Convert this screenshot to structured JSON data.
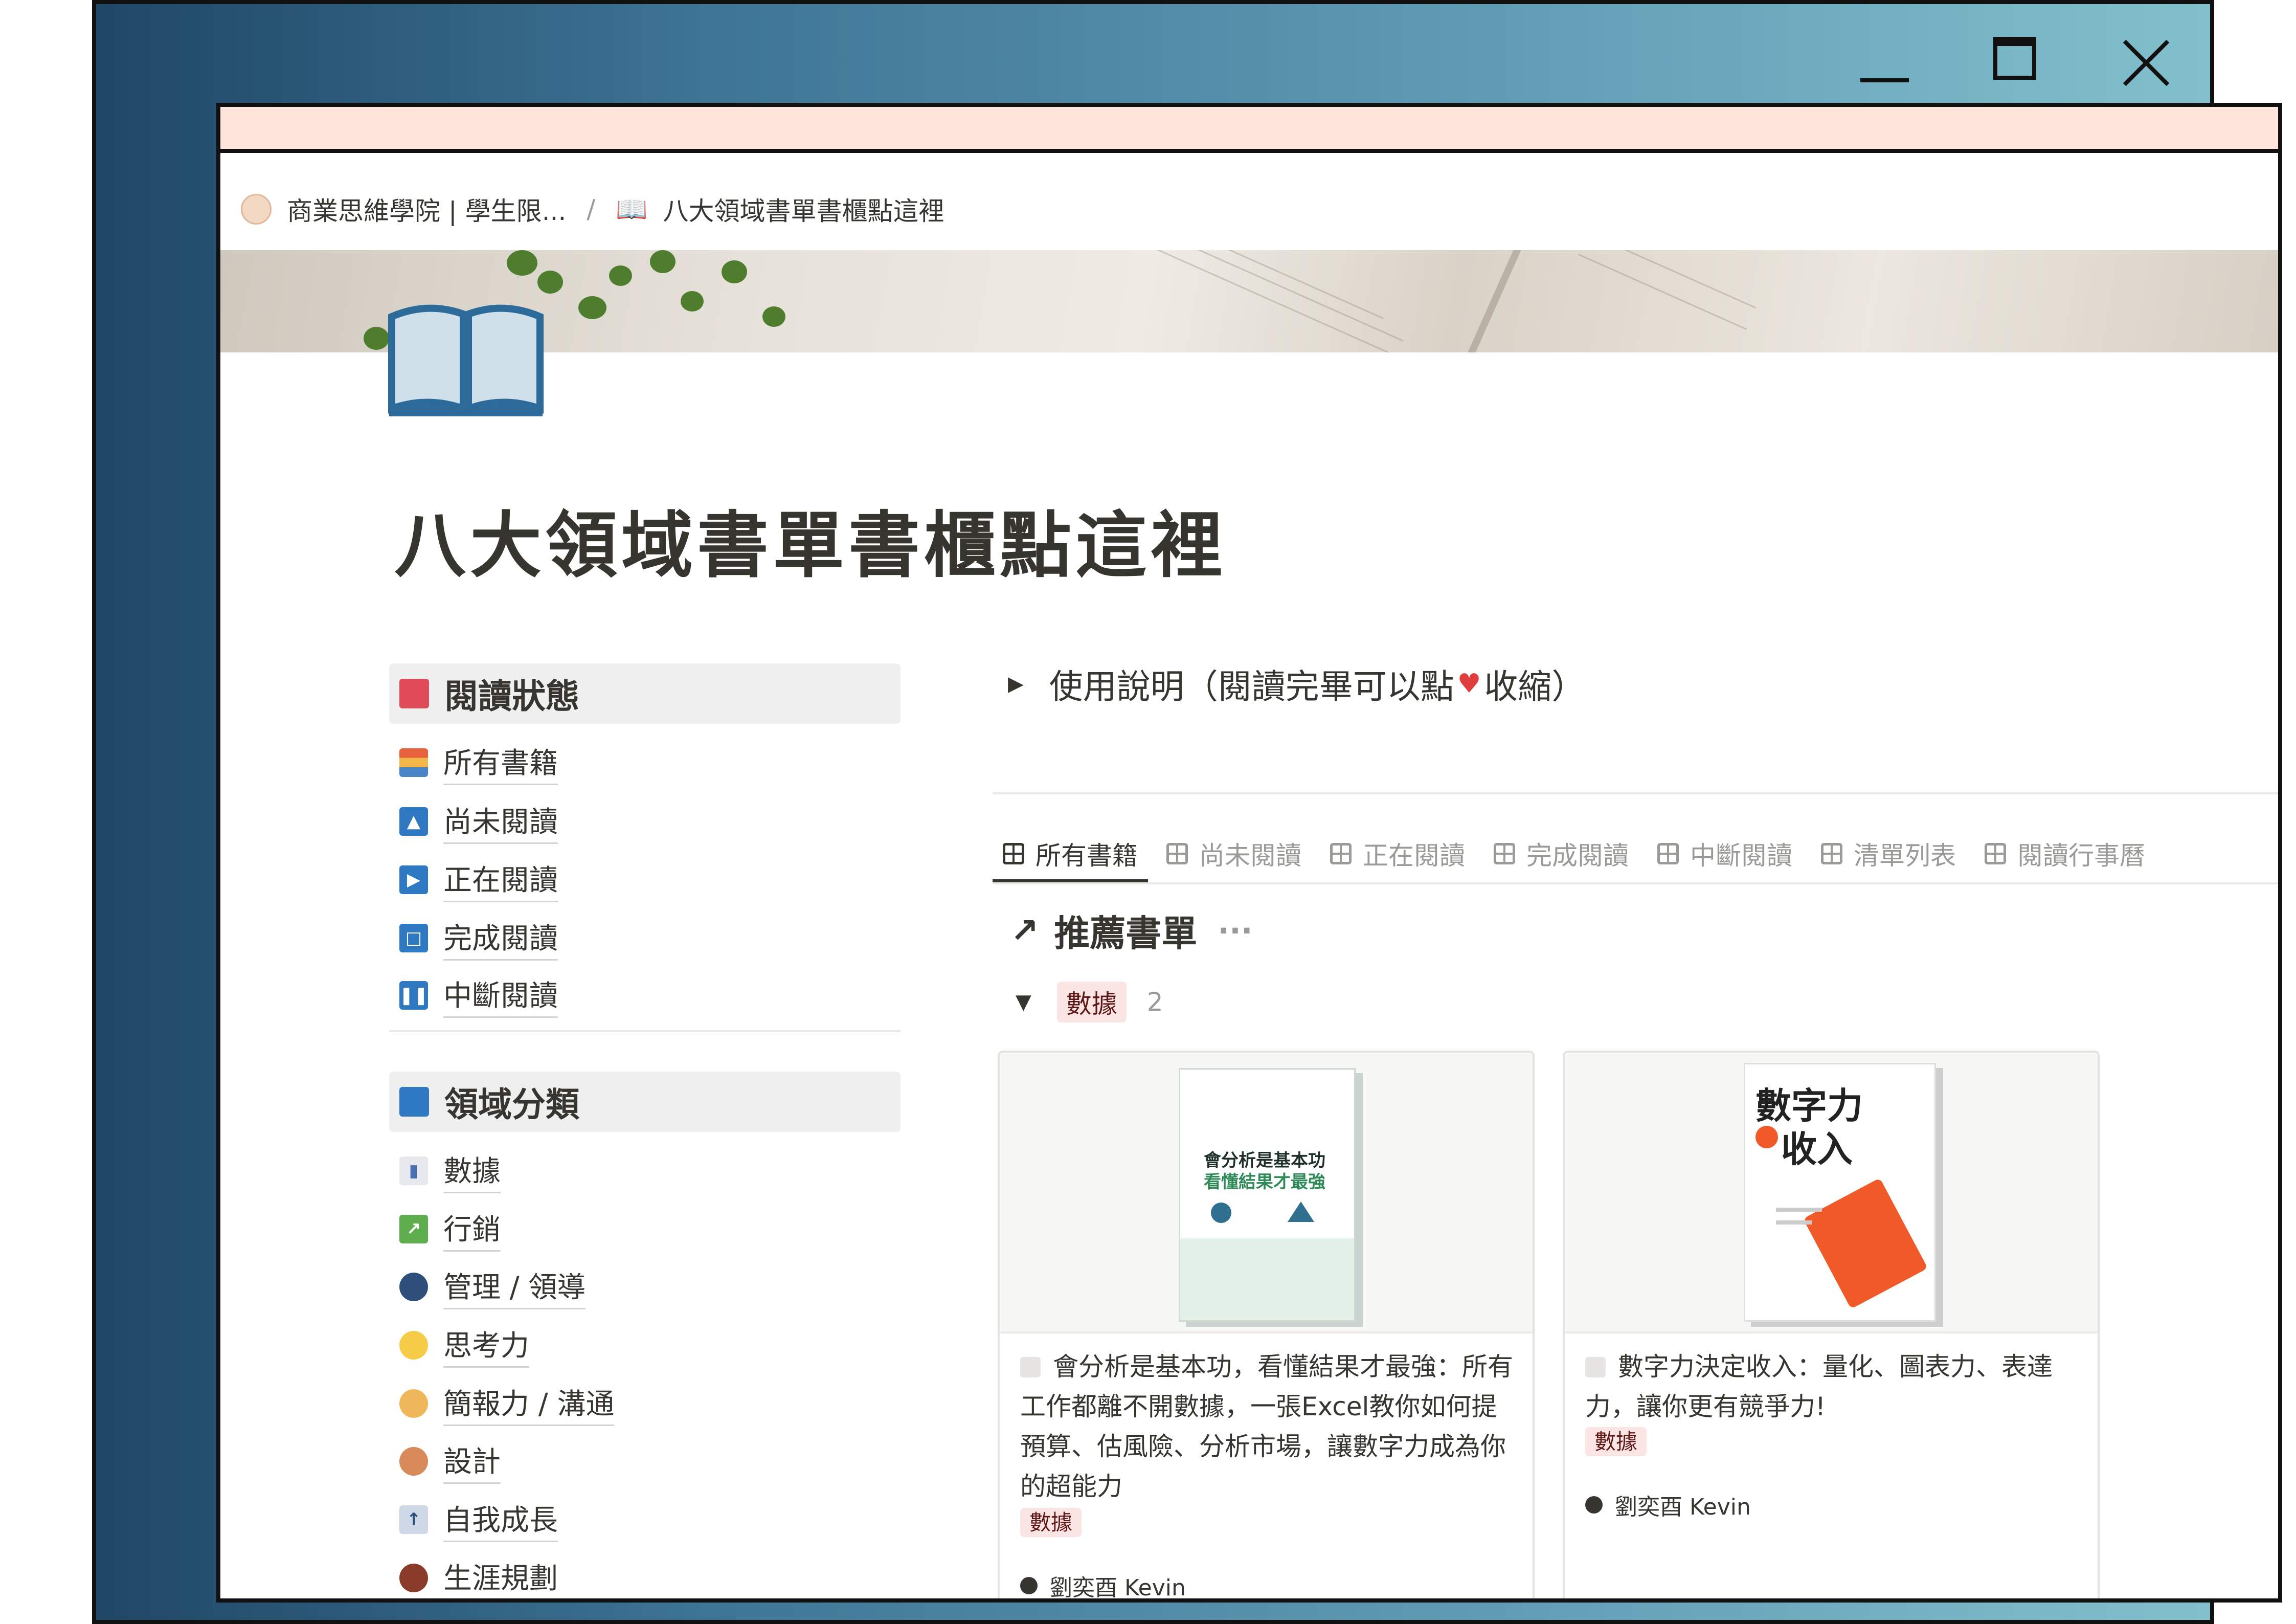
{
  "breadcrumb": {
    "parent": "商業思維學院 | 學生限...",
    "separator": "/",
    "current": "八大領域書單書櫃點這裡"
  },
  "page": {
    "icon": "open-book-icon",
    "title": "八大領域書單書櫃點這裡"
  },
  "sidebar": {
    "status_heading": "閱讀狀態",
    "status_items": [
      {
        "label": "所有書籍",
        "icon": "books-stack-icon"
      },
      {
        "label": "尚未閱讀",
        "icon": "eject-icon"
      },
      {
        "label": "正在閱讀",
        "icon": "play-icon"
      },
      {
        "label": "完成閱讀",
        "icon": "stop-square-icon"
      },
      {
        "label": "中斷閱讀",
        "icon": "pause-icon"
      }
    ],
    "domain_heading": "領域分類",
    "domain_items": [
      {
        "label": "數據",
        "icon": "bar-chart-icon"
      },
      {
        "label": "行銷",
        "icon": "chart-up-icon"
      },
      {
        "label": "管理 / 領導",
        "icon": "speaking-head-icon"
      },
      {
        "label": "思考力",
        "icon": "lightbulb-icon"
      },
      {
        "label": "簡報力 / 溝通",
        "icon": "presenter-icon"
      },
      {
        "label": "設計",
        "icon": "palette-icon"
      },
      {
        "label": "自我成長",
        "icon": "up-arrow-icon"
      },
      {
        "label": "生涯規劃",
        "icon": "footprints-icon"
      }
    ]
  },
  "toggle": {
    "before": "使用說明（閱讀完畢可以點",
    "heart": "♥",
    "after": "收縮）"
  },
  "tabs": [
    {
      "label": "所有書籍",
      "active": true
    },
    {
      "label": "尚未閱讀",
      "active": false
    },
    {
      "label": "正在閱讀",
      "active": false
    },
    {
      "label": "完成閱讀",
      "active": false
    },
    {
      "label": "中斷閱讀",
      "active": false
    },
    {
      "label": "清單列表",
      "active": false
    },
    {
      "label": "閱讀行事曆",
      "active": false
    }
  ],
  "linked_db": {
    "arrow": "↗",
    "title": "推薦書單",
    "more": "···"
  },
  "group": {
    "tag": "數據",
    "count": "2"
  },
  "cards": [
    {
      "cover_title": "會分析是基本功",
      "cover_subtitle": "看懂結果才最強",
      "title": "會分析是基本功，看懂結果才最強：所有工作都離不開數據，一張Excel教你如何提預算、估風險、分析市場，讓數字力成為你的超能力",
      "tag": "數據",
      "author": "劉奕酉 Kevin"
    },
    {
      "cover_title": "數字力",
      "cover_subtitle": "收入",
      "title": "數字力決定收入：量化、圖表力、表達力，讓你更有競爭力!",
      "tag": "數據",
      "author": "劉奕酉 Kevin"
    }
  ],
  "colors": {
    "tag_bg": "#fbe4e4",
    "tag_text": "#5d1715",
    "accent_pink": "#fde5dc",
    "heart": "#e03e3e"
  }
}
